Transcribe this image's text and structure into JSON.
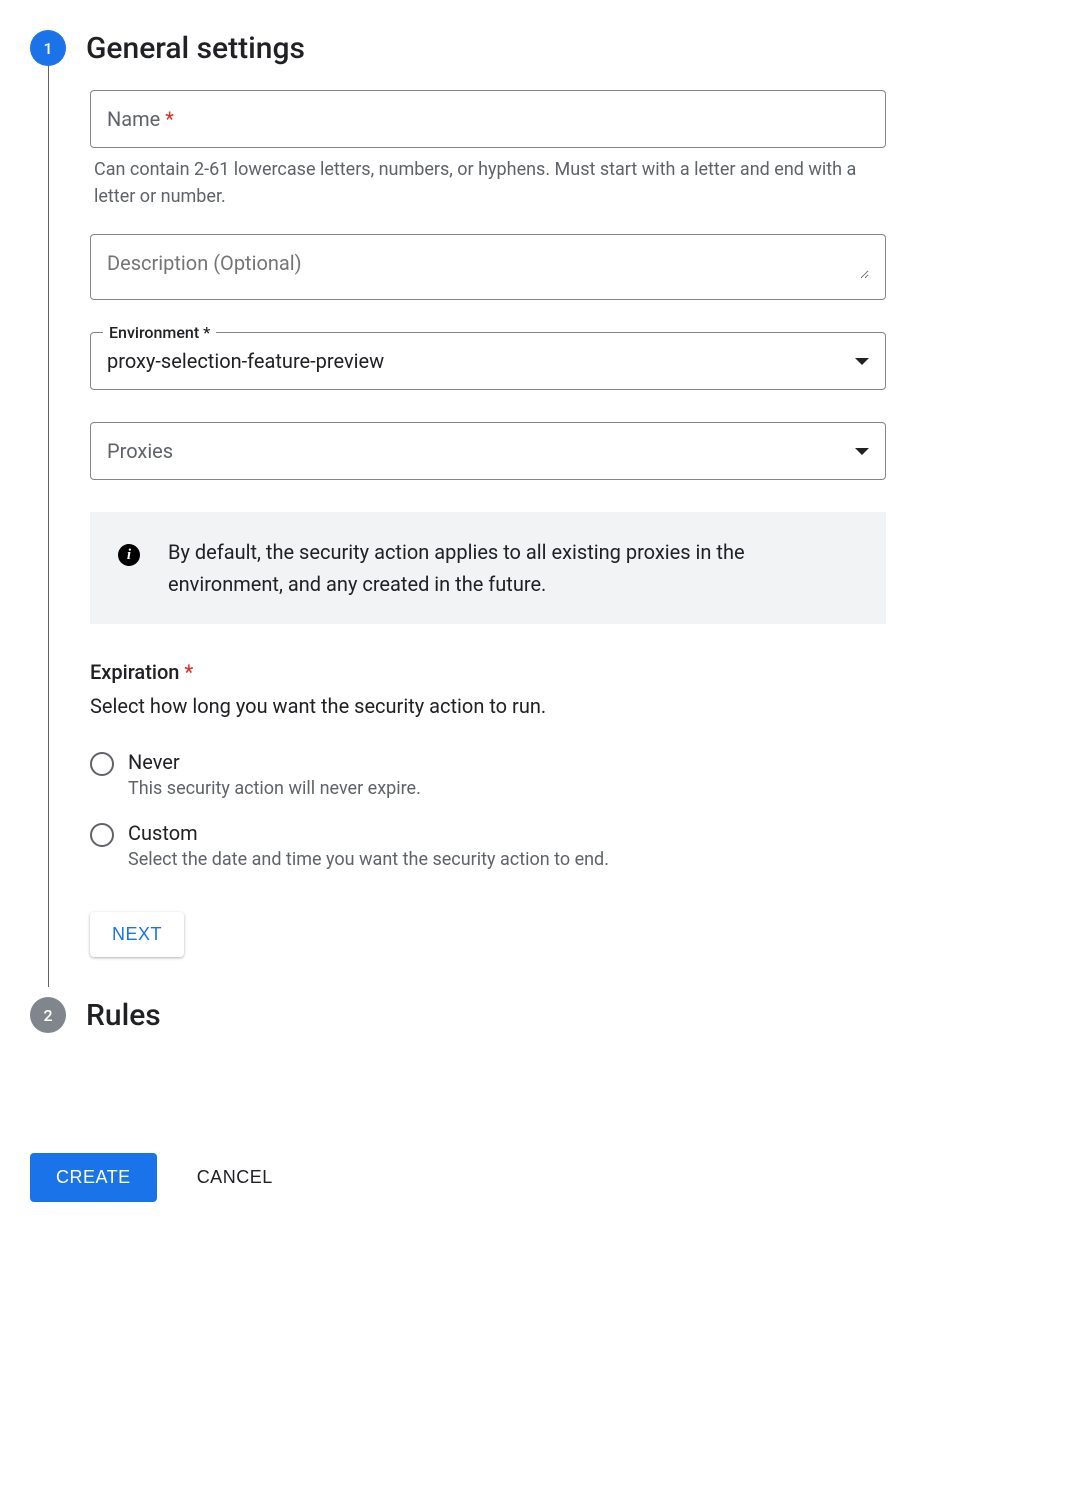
{
  "step1": {
    "number": "1",
    "title": "General settings",
    "name": {
      "label": "Name",
      "required": "*",
      "helper": "Can contain 2-61 lowercase letters, numbers, or hyphens. Must start with a letter and end with a letter or number."
    },
    "description": {
      "placeholder": "Description (Optional)"
    },
    "environment": {
      "label": "Environment *",
      "value": "proxy-selection-feature-preview"
    },
    "proxies": {
      "placeholder": "Proxies"
    },
    "info": "By default, the security action applies to all existing proxies in the environment, and any created in the future.",
    "expiration": {
      "label": "Expiration",
      "required": "*",
      "desc": "Select how long you want the security action to run.",
      "options": [
        {
          "label": "Never",
          "helper": "This security action will never expire."
        },
        {
          "label": "Custom",
          "helper": "Select the date and time you want the security action to end."
        }
      ]
    },
    "next_button": "NEXT"
  },
  "step2": {
    "number": "2",
    "title": "Rules"
  },
  "footer": {
    "create": "CREATE",
    "cancel": "CANCEL"
  }
}
